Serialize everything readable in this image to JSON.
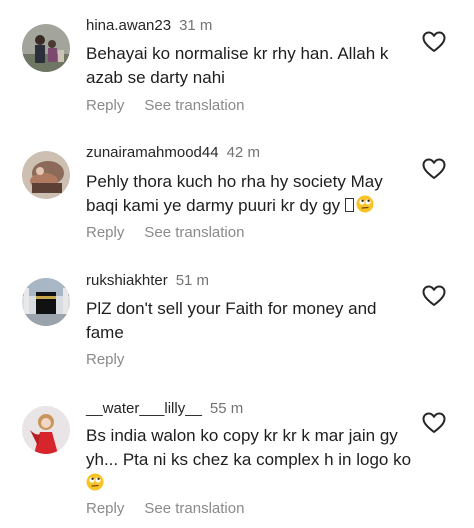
{
  "comments": [
    {
      "username": "hina.awan23",
      "time": "31 m",
      "text": "Behayai ko normalise kr rhy han. Allah k azab se darty nahi",
      "actions": [
        "Reply",
        "See translation"
      ]
    },
    {
      "username": "zunairamahmood44",
      "time": "42 m",
      "text": "Pehly thora kuch ho rha hy society May baqi kami ye darmy puuri kr dy gy",
      "actions": [
        "Reply",
        "See translation"
      ],
      "trailing_emoji": "face-with-rolling-eyes"
    },
    {
      "username": "rukshiakhter",
      "time": "51 m",
      "text": "PlZ  don't sell your Faith for money and fame",
      "actions": [
        "Reply"
      ]
    },
    {
      "username": "__water___lilly__",
      "time": "55 m",
      "text": "Bs india walon ko copy kr kr k mar jain gy yh... Pta ni ks chez ka complex h in logo ko",
      "actions": [
        "Reply",
        "See translation"
      ],
      "trailing_emoji": "face-with-rolling-eyes"
    }
  ],
  "icons": {
    "like": "heart-outline-icon",
    "emoji": "face-with-rolling-eyes"
  },
  "colors": {
    "username": "#262626",
    "secondary": "#737373",
    "action": "#8a8a8a",
    "emoji_face": "#f7c325"
  }
}
